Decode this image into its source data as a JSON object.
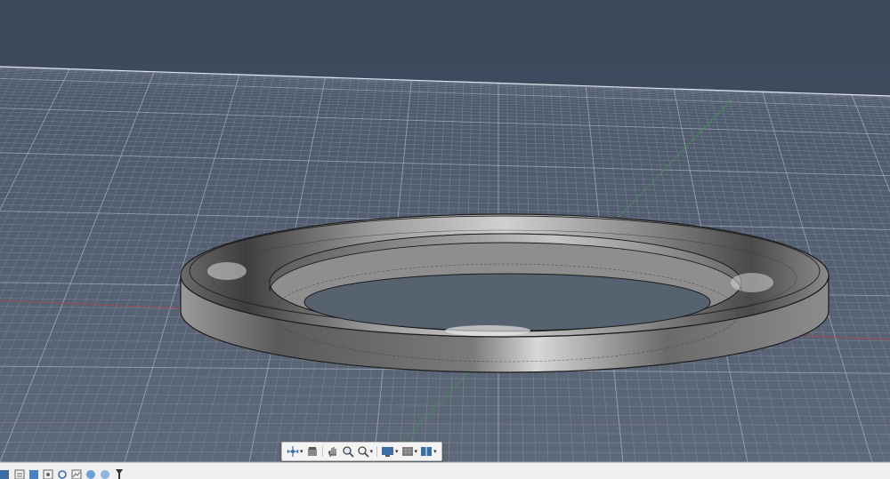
{
  "viewport": {
    "background_top": "#3f4b5e",
    "background_bottom": "#5a6677",
    "grid_color": "#c8d0dc",
    "x_axis_color": "#b0454b",
    "y_axis_color": "#3f9a4f"
  },
  "model": {
    "name": "ring",
    "body_color": "#6f6f6f",
    "highlight_color": "#e4e4e4",
    "edge_color": "#1c1c1c"
  },
  "navigation_toolbar": {
    "buttons": [
      {
        "name": "orbit-icon",
        "has_menu": true
      },
      {
        "name": "look-at-icon",
        "has_menu": false
      },
      {
        "name": "pan-icon",
        "has_menu": false
      },
      {
        "name": "zoom-icon",
        "has_menu": false
      },
      {
        "name": "zoom-window-icon",
        "has_menu": true
      },
      {
        "name": "display-settings-icon",
        "has_menu": true
      },
      {
        "name": "grid-snap-icon",
        "has_menu": true
      },
      {
        "name": "viewports-icon",
        "has_menu": true
      }
    ]
  },
  "browser_bar": {
    "icons": [
      "document-icon",
      "unit-icon",
      "named-views-icon",
      "origin-icon",
      "settings-icon",
      "analysis-icon",
      "render-icon",
      "timeline-marker-icon"
    ]
  }
}
